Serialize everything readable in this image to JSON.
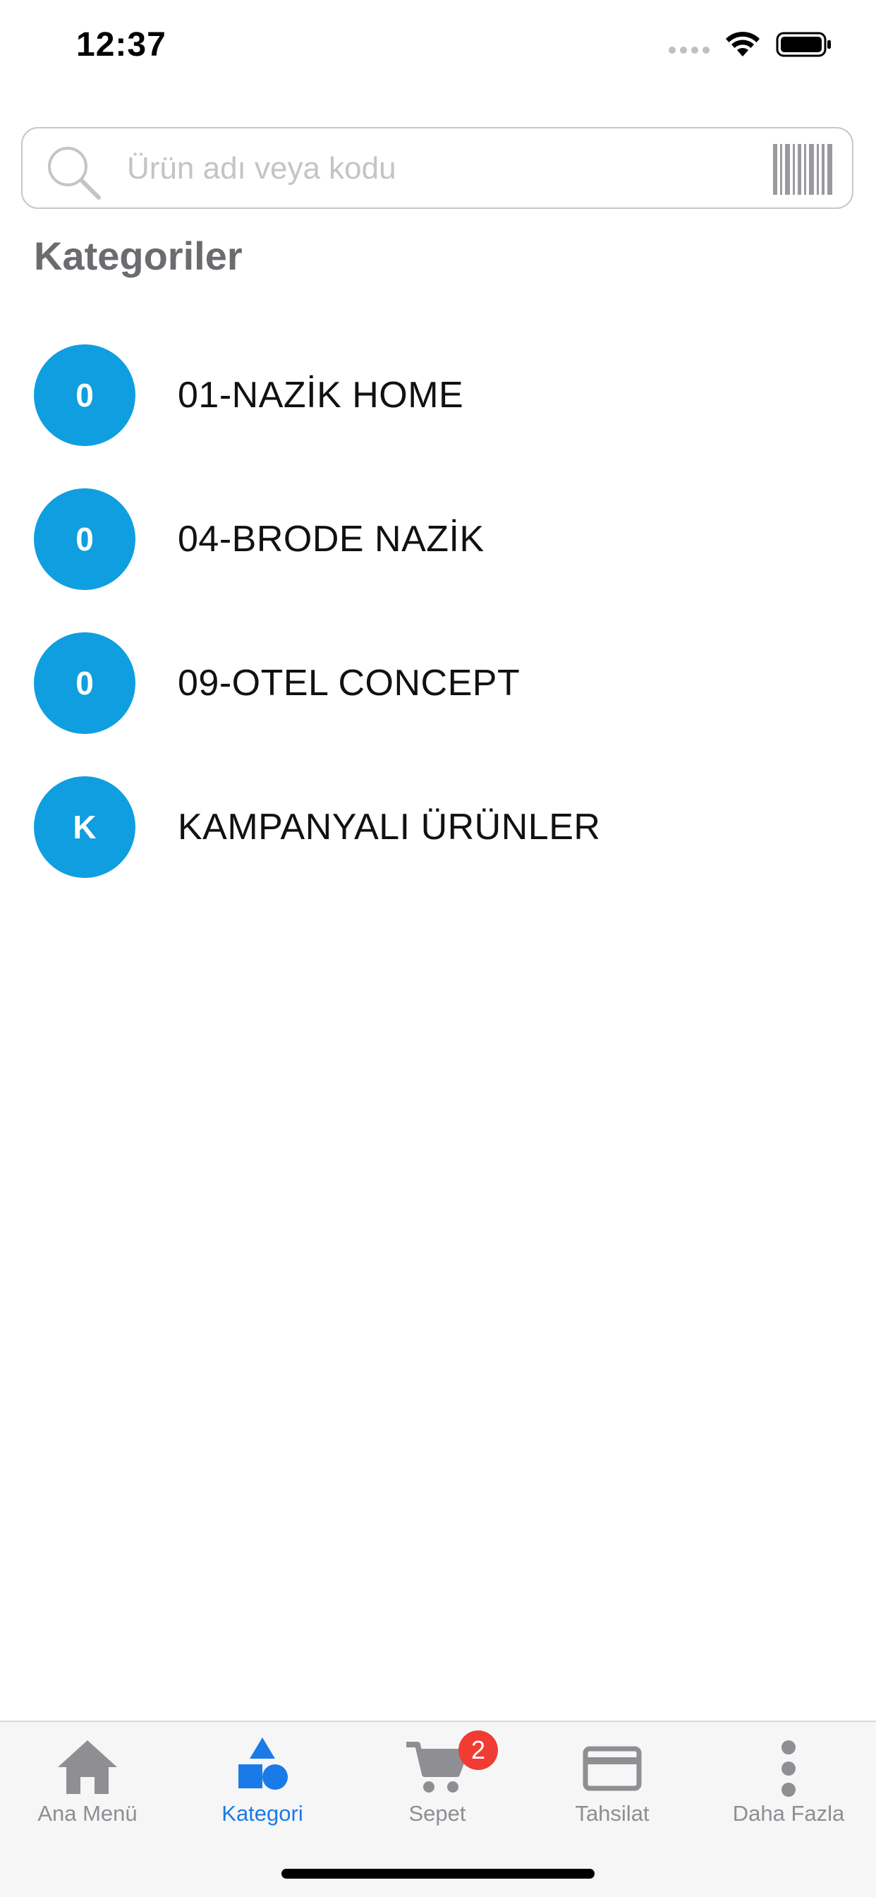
{
  "status_bar": {
    "time": "12:37"
  },
  "search": {
    "placeholder": "Ürün adı veya kodu",
    "value": ""
  },
  "section_title": "Kategoriler",
  "categories": [
    {
      "initial": "0",
      "label": "01-NAZİK HOME"
    },
    {
      "initial": "0",
      "label": "04-BRODE NAZİK"
    },
    {
      "initial": "0",
      "label": "09-OTEL CONCEPT"
    },
    {
      "initial": "K",
      "label": "KAMPANYALI ÜRÜNLER"
    }
  ],
  "tab_bar": {
    "tabs": [
      {
        "label": "Ana Menü",
        "icon": "home-icon",
        "active": false
      },
      {
        "label": "Kategori",
        "icon": "shapes-icon",
        "active": true
      },
      {
        "label": "Sepet",
        "icon": "cart-icon",
        "active": false,
        "badge": "2"
      },
      {
        "label": "Tahsilat",
        "icon": "credit-card-icon",
        "active": false
      },
      {
        "label": "Daha Fazla",
        "icon": "more-vertical-icon",
        "active": false
      }
    ]
  },
  "colors": {
    "accent": "#1a7ae8",
    "avatar": "#0f9ee0",
    "badge": "#f03c32",
    "inactive_tab": "#8e8e93"
  }
}
